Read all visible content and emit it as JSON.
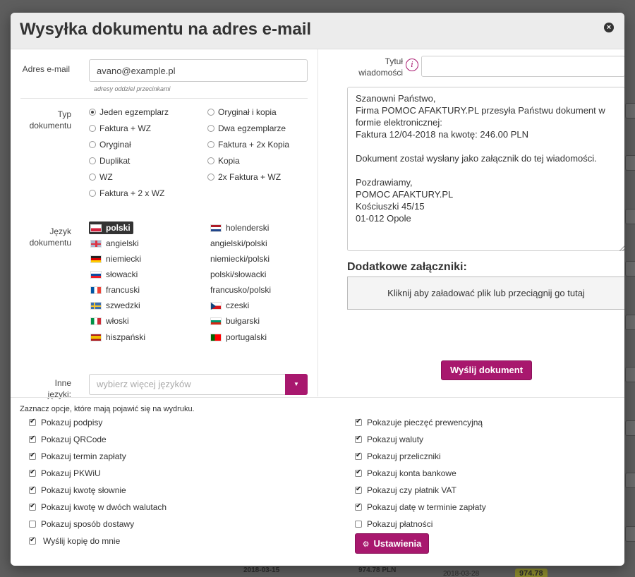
{
  "modal": {
    "title": "Wysyłka dokumentu na adres e-mail",
    "close_glyph": "×"
  },
  "email": {
    "label": "Adres e-mail",
    "value": "avano@example.pl",
    "hint": "adresy oddziel przecinkami"
  },
  "doc_type": {
    "label_line1": "Typ",
    "label_line2": "dokumentu",
    "options": [
      {
        "label": "Jeden egzemplarz",
        "selected": true
      },
      {
        "label": "Oryginał i kopia",
        "selected": false
      },
      {
        "label": "Faktura + WZ",
        "selected": false
      },
      {
        "label": "Dwa egzemplarze",
        "selected": false
      },
      {
        "label": "Oryginał",
        "selected": false
      },
      {
        "label": "Faktura + 2x Kopia",
        "selected": false
      },
      {
        "label": "Duplikat",
        "selected": false
      },
      {
        "label": "Kopia",
        "selected": false
      },
      {
        "label": "WZ",
        "selected": false
      },
      {
        "label": "2x Faktura + WZ",
        "selected": false
      },
      {
        "label": "Faktura + 2 x WZ",
        "selected": false
      }
    ]
  },
  "language": {
    "label_line1": "Język",
    "label_line2": "dokumentu",
    "items": [
      {
        "label": "polski",
        "flag": "pl",
        "selected": true
      },
      {
        "label": "holenderski",
        "flag": "nl"
      },
      {
        "label": "angielski",
        "flag": "gb"
      },
      {
        "label": "angielski/polski",
        "flag": ""
      },
      {
        "label": "niemiecki",
        "flag": "de"
      },
      {
        "label": "niemiecki/polski",
        "flag": ""
      },
      {
        "label": "słowacki",
        "flag": "sk"
      },
      {
        "label": "polski/słowacki",
        "flag": ""
      },
      {
        "label": "francuski",
        "flag": "fr"
      },
      {
        "label": "francusko/polski",
        "flag": ""
      },
      {
        "label": "szwedzki",
        "flag": "se"
      },
      {
        "label": "czeski",
        "flag": "cz"
      },
      {
        "label": "włoski",
        "flag": "it"
      },
      {
        "label": "bułgarski",
        "flag": "bg"
      },
      {
        "label": "hiszpański",
        "flag": "es"
      },
      {
        "label": "portugalski",
        "flag": "pt"
      }
    ]
  },
  "other_languages": {
    "label_line1": "Inne",
    "label_line2": "języki:",
    "placeholder": "wybierz więcej języków",
    "dropdown_glyph": "▼"
  },
  "subject": {
    "label_line1": "Tytuł",
    "label_line2": "wiadomości",
    "info_glyph": "i",
    "value": ""
  },
  "message": {
    "body": "Szanowni Państwo,\nFirma POMOC AFAKTURY.PL przesyła Państwu dokument w formie elektronicznej:\nFaktura 12/04-2018 na kwotę: 246.00 PLN\n\nDokument został wysłany jako załącznik do tej wiadomości.\n\nPozdrawiamy,\nPOMOC AFAKTURY.PL\nKościuszki 45/15\n01-012 Opole"
  },
  "attachments": {
    "heading": "Dodatkowe załączniki:",
    "dropzone": "Kliknij aby załadować plik lub przeciągnij go tutaj"
  },
  "send_button": "Wyślij dokument",
  "print_options": {
    "hint": "Zaznacz opcje, które mają pojawić się na wydruku.",
    "left": [
      {
        "label": "Pokazuj podpisy",
        "checked": true
      },
      {
        "label": "Pokazuj QRCode",
        "checked": true
      },
      {
        "label": "Pokazuj termin zapłaty",
        "checked": true
      },
      {
        "label": "Pokazuj PKWiU",
        "checked": true
      },
      {
        "label": "Pokazuj kwotę słownie",
        "checked": true
      },
      {
        "label": "Pokazuj kwotę w dwóch walutach",
        "checked": true
      },
      {
        "label": "Pokazuj sposób dostawy",
        "checked": false
      },
      {
        "label": "Wyślij kopię do mnie",
        "checked": true
      }
    ],
    "right": [
      {
        "label": "Pokazuje pieczęć prewencyjną",
        "checked": true
      },
      {
        "label": "Pokazuj waluty",
        "checked": true
      },
      {
        "label": "Pokazuj przeliczniki",
        "checked": true
      },
      {
        "label": "Pokazuj konta bankowe",
        "checked": true
      },
      {
        "label": "Pokazuj czy płatnik VAT",
        "checked": true
      },
      {
        "label": "Pokazuj datę w terminie zapłaty",
        "checked": true
      },
      {
        "label": "Pokazuj płatności",
        "checked": false
      }
    ],
    "settings_button": "Ustawienia",
    "settings_icon": "gear-icon"
  },
  "background": {
    "date": "2018-03-15",
    "amount": "974.78 PLN",
    "date2": "2018-03-28",
    "badge_amount": "974.78"
  },
  "colors": {
    "accent": "#a8186e"
  }
}
